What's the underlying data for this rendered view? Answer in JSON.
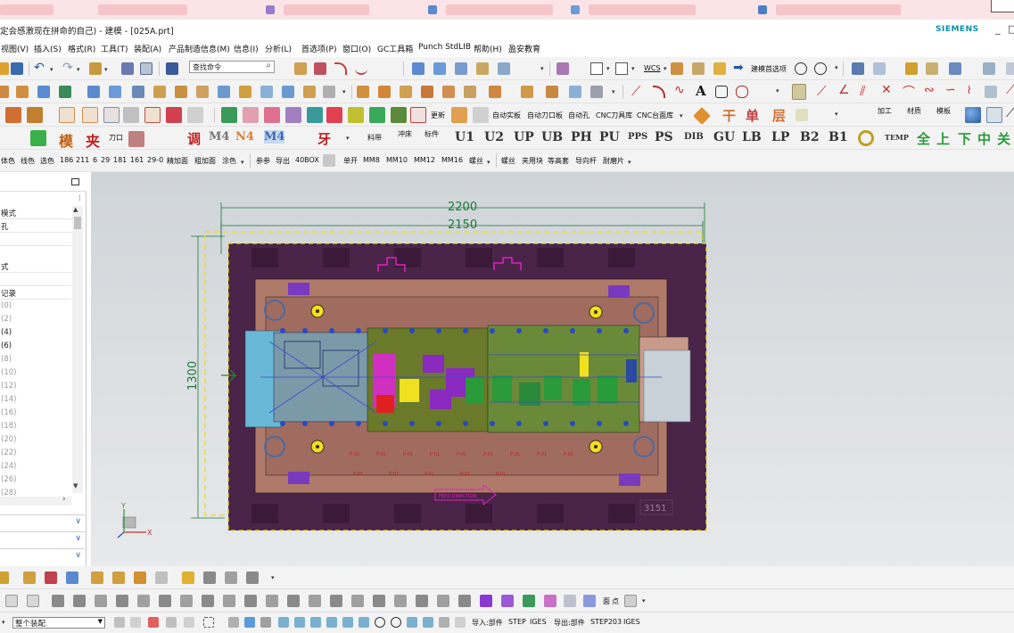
{
  "window": {
    "title": "定会感激现在拼命的自己) - 建模 - [025A.prt]",
    "brand": "SIEMENS",
    "min_glyph": "_",
    "max_glyph": "□"
  },
  "menu": [
    "视图(V)",
    "插入(S)",
    "格式(R)",
    "工具(T)",
    "装配(A)",
    "产品制造信息(M)",
    "信息(I)",
    "分析(L)",
    "首选项(P)",
    "窗口(O)",
    "GC工具箱",
    "Punch StdLIB",
    "帮助(H)",
    "盈安教育"
  ],
  "toolbar1": {
    "search_value": "查找命令",
    "wcs_label": "WCS",
    "preferences_label": "建模首选项"
  },
  "toolbar2": {
    "text_tool_glyph": "A"
  },
  "toolbar3": {
    "buttons": [
      "自动实板",
      "自动刀口板",
      "自动孔",
      "CNC刀具库",
      "CNC台面库",
      "更新"
    ],
    "glyphs": [
      "干",
      "单",
      "层"
    ],
    "small_labels": [
      "加工",
      "材质",
      "模板"
    ]
  },
  "toolbar4": {
    "glyphs": [
      "模",
      "夹",
      "调",
      "M4",
      "N4",
      "M4",
      "牙",
      "U1",
      "U2",
      "UP",
      "UB",
      "PH",
      "PU",
      "PPS",
      "PS",
      "DIB",
      "GU",
      "LB",
      "LP",
      "B2",
      "B1",
      "TEMP",
      "全",
      "上",
      "下",
      "中",
      "关"
    ],
    "small_labels": [
      "刀口",
      "料带",
      "冲床",
      "标件"
    ]
  },
  "toolbar5": {
    "left_items": [
      "体色",
      "线色",
      "选色",
      "186",
      "211",
      "6",
      "29",
      "181",
      "161",
      "29-0",
      "精加面",
      "粗加面",
      "涂色"
    ],
    "mid_items": [
      "参参",
      "导出",
      "40BOX"
    ],
    "right_items": [
      "单开",
      "MM8",
      "MM10",
      "MM12",
      "MM16",
      "螺丝"
    ],
    "far_items": [
      "螺丝",
      "夹用块",
      "等高套",
      "导向杆",
      "耐磨片"
    ]
  },
  "sidebar": {
    "rows": [
      {
        "label": "模式",
        "dim": false
      },
      {
        "label": "孔",
        "dim": false
      },
      {
        "label": "",
        "dim": false
      },
      {
        "label": "式",
        "dim": false
      },
      {
        "label": "",
        "dim": false
      },
      {
        "label": "记录",
        "dim": false
      },
      {
        "label": "(0)",
        "dim": true
      },
      {
        "label": "(2)",
        "dim": true
      },
      {
        "label": "(4)",
        "dim": false
      },
      {
        "label": "(6)",
        "dim": false
      },
      {
        "label": "(8)",
        "dim": true
      },
      {
        "label": "(10)",
        "dim": true
      },
      {
        "label": "(12)",
        "dim": true
      },
      {
        "label": "(14)",
        "dim": true
      },
      {
        "label": "(16)",
        "dim": true
      },
      {
        "label": "(18)",
        "dim": true
      },
      {
        "label": "(20)",
        "dim": true
      },
      {
        "label": "(22)",
        "dim": true
      },
      {
        "label": "(24)",
        "dim": true
      },
      {
        "label": "(26)",
        "dim": true
      },
      {
        "label": "(28)",
        "dim": true
      }
    ]
  },
  "viewport": {
    "dim_top_outer": "2200",
    "dim_top_inner": "2150",
    "dim_left": "1300",
    "axis_x": "X",
    "axis_y": "Y",
    "corner_code": "3151",
    "feed_label": "FEED DIRECTION"
  },
  "bottombar2": {
    "glyphs": [
      "面",
      "点"
    ]
  },
  "statusbar": {
    "select_value": "整个装配",
    "import_label": "导入:部件",
    "step_label": "STEP",
    "iges_label": "IGES",
    "export_label": "导出:部件",
    "step203_label": "STEP203",
    "iges2_label": "IGES"
  }
}
